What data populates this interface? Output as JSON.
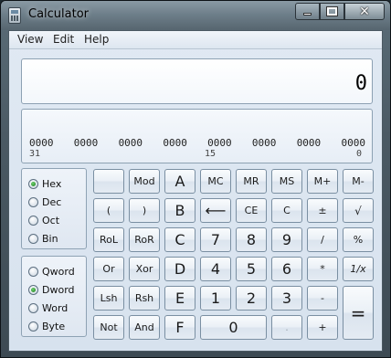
{
  "window": {
    "title": "Calculator"
  },
  "menu": {
    "view": "View",
    "edit": "Edit",
    "help": "Help"
  },
  "display": {
    "value": "0"
  },
  "bits": {
    "groups": [
      "0000",
      "0000",
      "0000",
      "0000",
      "0000",
      "0000",
      "0000",
      "0000"
    ],
    "pos_left": "31",
    "pos_mid": "15",
    "pos_right": "0"
  },
  "base": {
    "hex": "Hex",
    "dec": "Dec",
    "oct": "Oct",
    "bin": "Bin",
    "selected": "Hex"
  },
  "word": {
    "qword": "Qword",
    "dword": "Dword",
    "word": "Word",
    "byte": "Byte",
    "selected": "Dword"
  },
  "keys": {
    "mod": "Mod",
    "a": "A",
    "mc": "MC",
    "mr": "MR",
    "ms": "MS",
    "mplus": "M+",
    "mminus": "M-",
    "lparen": "(",
    "rparen": ")",
    "b": "B",
    "back": "⟵",
    "ce": "CE",
    "c": "C",
    "plusminus": "±",
    "sqrt": "√",
    "rol": "RoL",
    "ror": "RoR",
    "cc": "C",
    "seven": "7",
    "eight": "8",
    "nine": "9",
    "div": "/",
    "pct": "%",
    "or": "Or",
    "xor": "Xor",
    "d": "D",
    "four": "4",
    "five": "5",
    "six": "6",
    "mul": "*",
    "recip": "1/x",
    "lsh": "Lsh",
    "rsh": "Rsh",
    "e": "E",
    "one": "1",
    "two": "2",
    "three": "3",
    "minus": "-",
    "equals": "=",
    "not": "Not",
    "and": "And",
    "f": "F",
    "zero": "0",
    "dot": ".",
    "plus": "+"
  }
}
